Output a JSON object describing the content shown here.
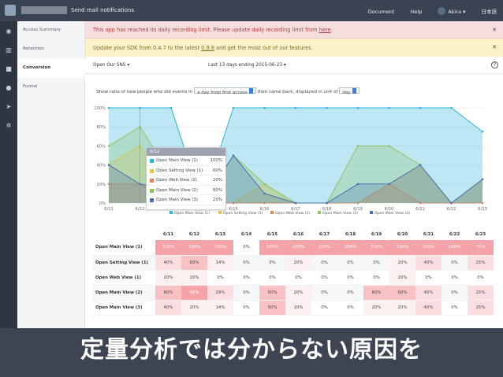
{
  "topbar": {
    "notification_label": "Send mail notifications",
    "nav": [
      "Document",
      "Help"
    ],
    "user": "Akira ▾",
    "language": "日本語"
  },
  "sidebar": {
    "items": [
      {
        "label": "Access Summary"
      },
      {
        "label": "Retention"
      },
      {
        "label": "Conversion"
      },
      {
        "label": "Funnel"
      }
    ],
    "icons": [
      "dashboard-icon",
      "chart-icon",
      "video-icon",
      "user-icon",
      "send-icon",
      "gear-icon"
    ]
  },
  "alerts": {
    "red_text": "This app has reached its daily recording limit. Please update daily recording limit from ",
    "red_link": "here",
    "red_end": ".",
    "yellow_text_1": "Update your SDK from 0.4.7 to the latest ",
    "yellow_version": "0.9.8",
    "yellow_text_2": " and get the most out of our features."
  },
  "filters": {
    "dataset": "Open Our SNS ▾",
    "range": "Last 13 days ending 2015-06-23 ▾"
  },
  "controls": {
    "prefix": "Show ratio of new people who did events in",
    "period": "a day from first access",
    "middle": "then came back, displayed in unit of",
    "unit": "day"
  },
  "tooltip": {
    "date": "6/12",
    "rows": [
      {
        "label": "Open Main View (1)",
        "value": "100%",
        "color": "#2fb3d9"
      },
      {
        "label": "Open Setting View (1)",
        "value": "60%",
        "color": "#e8c34a"
      },
      {
        "label": "Open Web View (1)",
        "value": "20%",
        "color": "#e3855e"
      },
      {
        "label": "Open Main View (2)",
        "value": "80%",
        "color": "#8fc463"
      },
      {
        "label": "Open Main View (3)",
        "value": "20%",
        "color": "#4a6fb3"
      }
    ]
  },
  "chart_data": {
    "type": "area",
    "x": [
      "6/11",
      "6/12",
      "6/13",
      "6/14",
      "6/15",
      "6/16",
      "6/17",
      "6/18",
      "6/19",
      "6/20",
      "6/21",
      "6/22",
      "6/23"
    ],
    "yticks": [
      "0%",
      "20%",
      "40%",
      "60%",
      "80%",
      "100%"
    ],
    "ylim": [
      0,
      100
    ],
    "legend_position": "bottom",
    "series": [
      {
        "name": "Open Main View (1)",
        "color": "#2fb3d9",
        "values": [
          100,
          100,
          100,
          0,
          100,
          100,
          100,
          100,
          100,
          100,
          100,
          100,
          75
        ]
      },
      {
        "name": "Open Setting View (1)",
        "color": "#e8c34a",
        "values": [
          40,
          60,
          14,
          0,
          0,
          20,
          0,
          0,
          0,
          20,
          40,
          0,
          25
        ]
      },
      {
        "name": "Open Web View (1)",
        "color": "#e3855e",
        "values": [
          20,
          20,
          0,
          0,
          0,
          0,
          0,
          0,
          0,
          20,
          0,
          0,
          0
        ]
      },
      {
        "name": "Open Main View (2)",
        "color": "#8fc463",
        "values": [
          60,
          80,
          29,
          0,
          50,
          20,
          0,
          0,
          60,
          60,
          40,
          0,
          25
        ]
      },
      {
        "name": "Open Main View (3)",
        "color": "#4a6fb3",
        "values": [
          40,
          20,
          14,
          0,
          50,
          10,
          0,
          0,
          20,
          20,
          40,
          0,
          25
        ]
      }
    ]
  },
  "table": {
    "headers": [
      "6/11",
      "6/12",
      "6/13",
      "6/14",
      "6/15",
      "6/16",
      "6/17",
      "6/18",
      "6/19",
      "6/20",
      "6/21",
      "6/22",
      "6/23"
    ],
    "rows": [
      {
        "label": "Open Main View (1)",
        "cells": [
          "100%",
          "100%",
          "100%",
          "0%",
          "100%",
          "100%",
          "100%",
          "100%",
          "100%",
          "100%",
          "100%",
          "100%",
          "75%"
        ]
      },
      {
        "label": "Open Setting View (1)",
        "cells": [
          "40%",
          "60%",
          "14%",
          "0%",
          "0%",
          "20%",
          "0%",
          "0%",
          "0%",
          "20%",
          "40%",
          "0%",
          "25%"
        ]
      },
      {
        "label": "Open Web View (1)",
        "cells": [
          "20%",
          "20%",
          "0%",
          "0%",
          "0%",
          "0%",
          "0%",
          "0%",
          "0%",
          "20%",
          "0%",
          "0%",
          "0%"
        ]
      },
      {
        "label": "Open Main View (2)",
        "cells": [
          "60%",
          "80%",
          "29%",
          "0%",
          "50%",
          "20%",
          "0%",
          "0%",
          "60%",
          "60%",
          "40%",
          "0%",
          "25%"
        ]
      },
      {
        "label": "Open Main View (3)",
        "cells": [
          "40%",
          "20%",
          "14%",
          "0%",
          "50%",
          "10%",
          "0%",
          "0%",
          "20%",
          "20%",
          "40%",
          "0%",
          "25%"
        ]
      }
    ]
  },
  "caption": "定量分析では分からない原因を"
}
